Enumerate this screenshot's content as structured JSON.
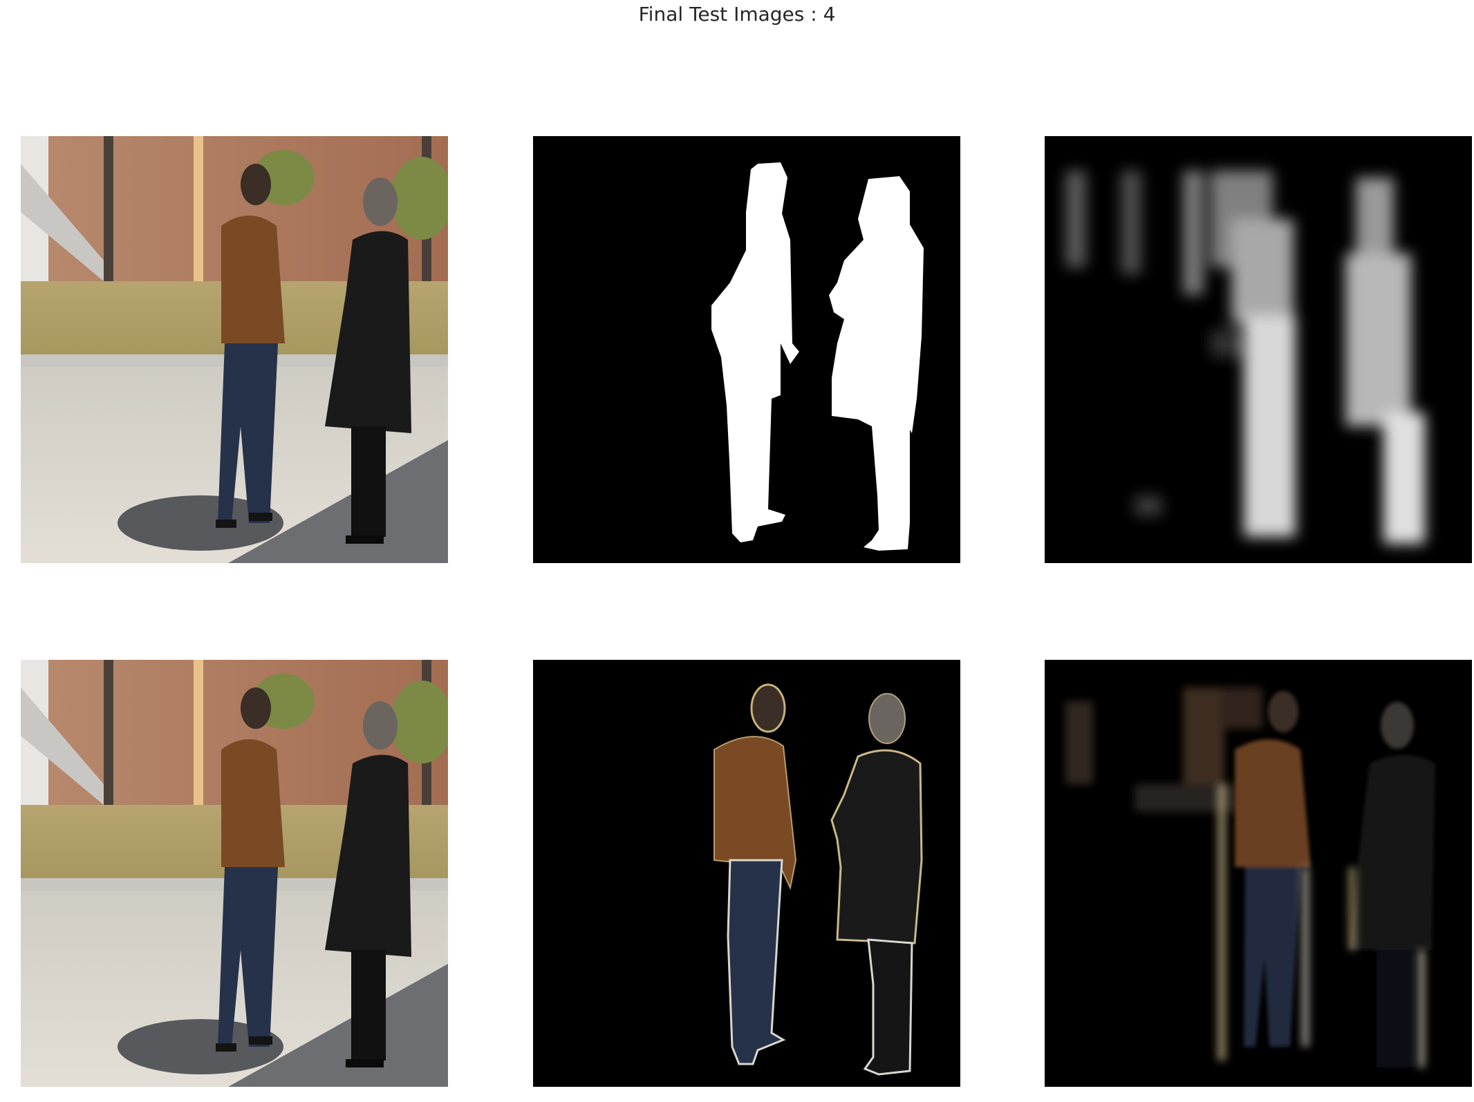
{
  "figure": {
    "title": "Final Test Images : 4"
  },
  "grid": {
    "rows": 2,
    "cols": 3,
    "panels": [
      {
        "id": "input-image",
        "row": 1,
        "col": 1
      },
      {
        "id": "ground-truth-mask",
        "row": 1,
        "col": 2
      },
      {
        "id": "predicted-mask",
        "row": 1,
        "col": 3
      },
      {
        "id": "input-image-copy",
        "row": 2,
        "col": 1
      },
      {
        "id": "ground-truth-masked-image",
        "row": 2,
        "col": 2
      },
      {
        "id": "predicted-masked-image",
        "row": 2,
        "col": 3
      }
    ]
  },
  "colors": {
    "background": "#ffffff",
    "mask_background": "#000000",
    "mask_foreground": "#ffffff",
    "title_text": "#262626"
  }
}
